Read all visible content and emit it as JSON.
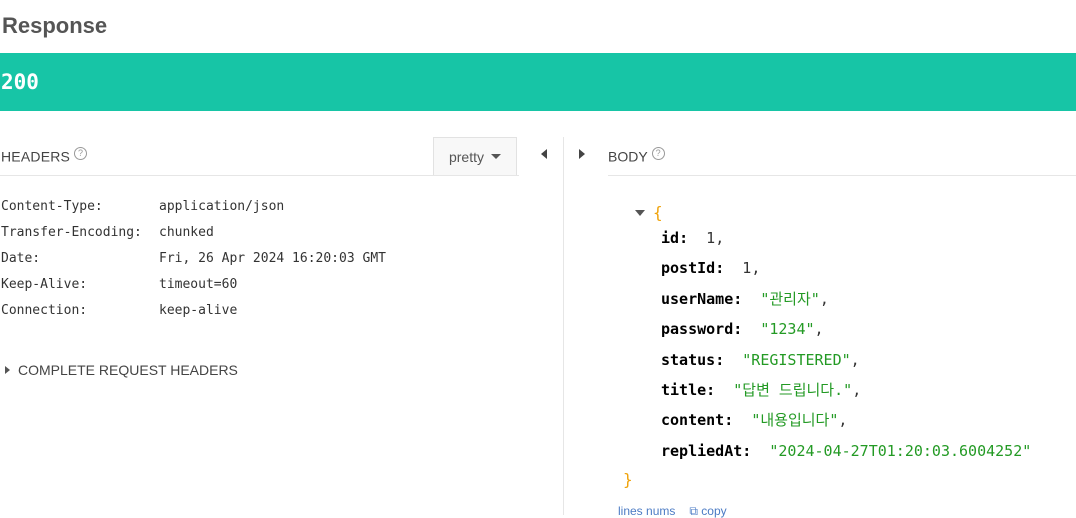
{
  "panel": {
    "title": "Response",
    "status_code": "200"
  },
  "headers": {
    "heading": "HEADERS",
    "help": "?",
    "format_select": "pretty",
    "rows": [
      {
        "name": "Content-Type:",
        "value": "application/json"
      },
      {
        "name": "Transfer-Encoding:",
        "value": "chunked"
      },
      {
        "name": "Date:",
        "value": "Fri, 26 Apr 2024 16:20:03 GMT"
      },
      {
        "name": "Keep-Alive:",
        "value": "timeout=60"
      },
      {
        "name": "Connection:",
        "value": "keep-alive"
      }
    ],
    "complete_toggle": "COMPLETE REQUEST HEADERS"
  },
  "body": {
    "heading": "BODY",
    "help": "?",
    "open_brace": "{",
    "close_brace": "}",
    "fields": [
      {
        "key": "id",
        "value": "1",
        "type": "number"
      },
      {
        "key": "postId",
        "value": "1",
        "type": "number"
      },
      {
        "key": "userName",
        "value": "\"관리자\"",
        "type": "string"
      },
      {
        "key": "password",
        "value": "\"1234\"",
        "type": "string"
      },
      {
        "key": "status",
        "value": "\"REGISTERED\"",
        "type": "string"
      },
      {
        "key": "title",
        "value": "\"답변 드립니다.\"",
        "type": "string"
      },
      {
        "key": "content",
        "value": "\"내용입니다\"",
        "type": "string"
      },
      {
        "key": "repliedAt",
        "value": "\"2024-04-27T01:20:03.6004252\"",
        "type": "string"
      }
    ],
    "footer": {
      "line_nums": "lines nums",
      "copy": "copy"
    }
  }
}
